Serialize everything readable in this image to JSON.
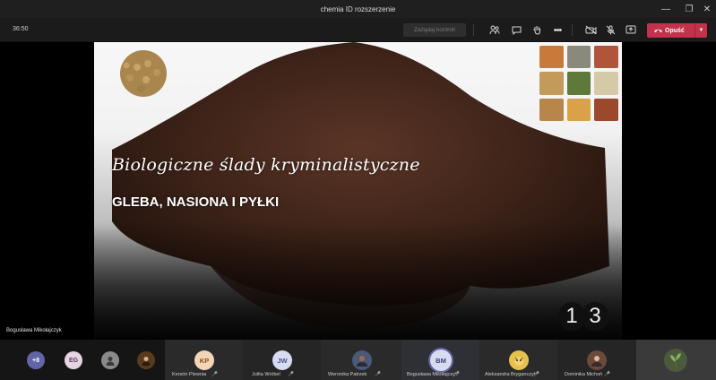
{
  "window": {
    "title": "chemia ID rozszerzenie"
  },
  "toolbar": {
    "timer": "36:50",
    "take_control_label": "Zażądaj kontroli",
    "leave_label": "Opuść"
  },
  "slide": {
    "title": "Biologiczne ślady kryminalistyczne",
    "subtitle": "GLEBA, NASIONA I PYŁKI",
    "page_number": "13"
  },
  "presenter": {
    "name": "Bogusława Mikołajczyk"
  },
  "participants_overflow": {
    "count_label": "+8",
    "initials": "EG"
  },
  "participants": [
    {
      "initials": "KP",
      "name": "Kersön Plewnia"
    },
    {
      "initials": "JW",
      "name": "Julita Wróbel"
    },
    {
      "initials": "",
      "name": "Weronika Patrzek"
    },
    {
      "initials": "BM",
      "name": "Bogusława Mikołajczyk"
    },
    {
      "initials": "",
      "name": "Aleksandra Bryganczyk"
    },
    {
      "initials": "",
      "name": "Dominika Michoń"
    }
  ],
  "colors": {
    "leave_red": "#c4314b",
    "teams_purple": "#6264a7",
    "toolbar_bg": "#1b1b1b"
  }
}
